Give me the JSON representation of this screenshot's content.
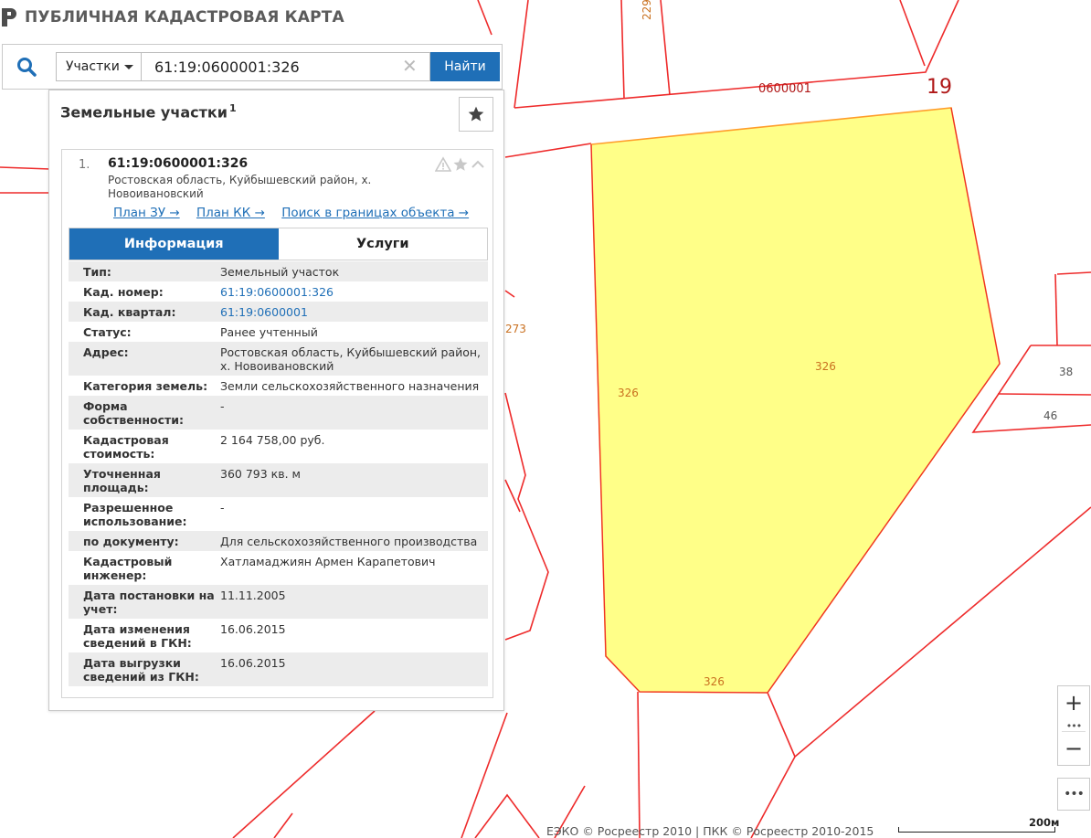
{
  "app": {
    "title": "ПУБЛИЧНАЯ КАДАСТРОВАЯ КАРТА"
  },
  "search": {
    "type_label": "Участки",
    "query": "61:19:0600001:326",
    "clear_symbol": "✕",
    "submit_label": "Найти"
  },
  "panel": {
    "title": "Земельные участки",
    "count": "1"
  },
  "result": {
    "index": "1.",
    "cadastral_number": "61:19:0600001:326",
    "address": "Ростовская область, Куйбышевский район, х. Новоивановский",
    "links": {
      "plan_zu": "План ЗУ →",
      "plan_kk": "План КК →",
      "search_inside": "Поиск в границах объекта →"
    },
    "tabs": {
      "info": "Информация",
      "services": "Услуги"
    },
    "fields": [
      {
        "label": "Тип:",
        "value": "Земельный участок",
        "link": false
      },
      {
        "label": "Кад. номер:",
        "value": "61:19:0600001:326",
        "link": true
      },
      {
        "label": "Кад. квартал:",
        "value": "61:19:0600001",
        "link": true
      },
      {
        "label": "Статус:",
        "value": "Ранее учтенный",
        "link": false
      },
      {
        "label": "Адрес:",
        "value": "Ростовская область, Куйбышевский район, х. Новоивановский",
        "link": false
      },
      {
        "label": "Категория земель:",
        "value": "Земли сельскохозяйственного назначения",
        "link": false
      },
      {
        "label": "Форма собственности:",
        "value": "-",
        "link": false
      },
      {
        "label": "Кадастровая стоимость:",
        "value": "2 164 758,00 руб.",
        "link": false
      },
      {
        "label": "Уточненная площадь:",
        "value": "360 793 кв. м",
        "link": false
      },
      {
        "label": "Разрешенное использование:",
        "value": "-",
        "link": false
      },
      {
        "label": "по документу:",
        "value": "Для сельскохозяйственного производства",
        "link": false
      },
      {
        "label": "Кадастровый инженер:",
        "value": "Хатламаджиян Армен Карапетович",
        "link": false
      },
      {
        "label": "Дата постановки на учет:",
        "value": "11.11.2005",
        "link": false
      },
      {
        "label": "Дата изменения сведений в ГКН:",
        "value": "16.06.2015",
        "link": false
      },
      {
        "label": "Дата выгрузки сведений из ГКН:",
        "value": "16.06.2015",
        "link": false
      }
    ]
  },
  "map": {
    "labels": {
      "quarter": "0600001",
      "district": "19",
      "top_parcel": "229",
      "parcel_273": "273",
      "parcel_326": "326",
      "parcel_38": "38",
      "parcel_46": "46"
    },
    "colors": {
      "parcel_fill": "#ffff88",
      "parcel_stroke": "#ff9d2a",
      "boundary": "#ee2b2b",
      "accent": "#1f6fb7"
    }
  },
  "controls": {
    "zoom_in": "+",
    "zoom_more": "•••",
    "zoom_out": "−",
    "more": "•••"
  },
  "footer": {
    "copyright": "ЕЭКО © Росреестр 2010 | ПКК © Росреестр 2010-2015",
    "scale": "200м"
  }
}
